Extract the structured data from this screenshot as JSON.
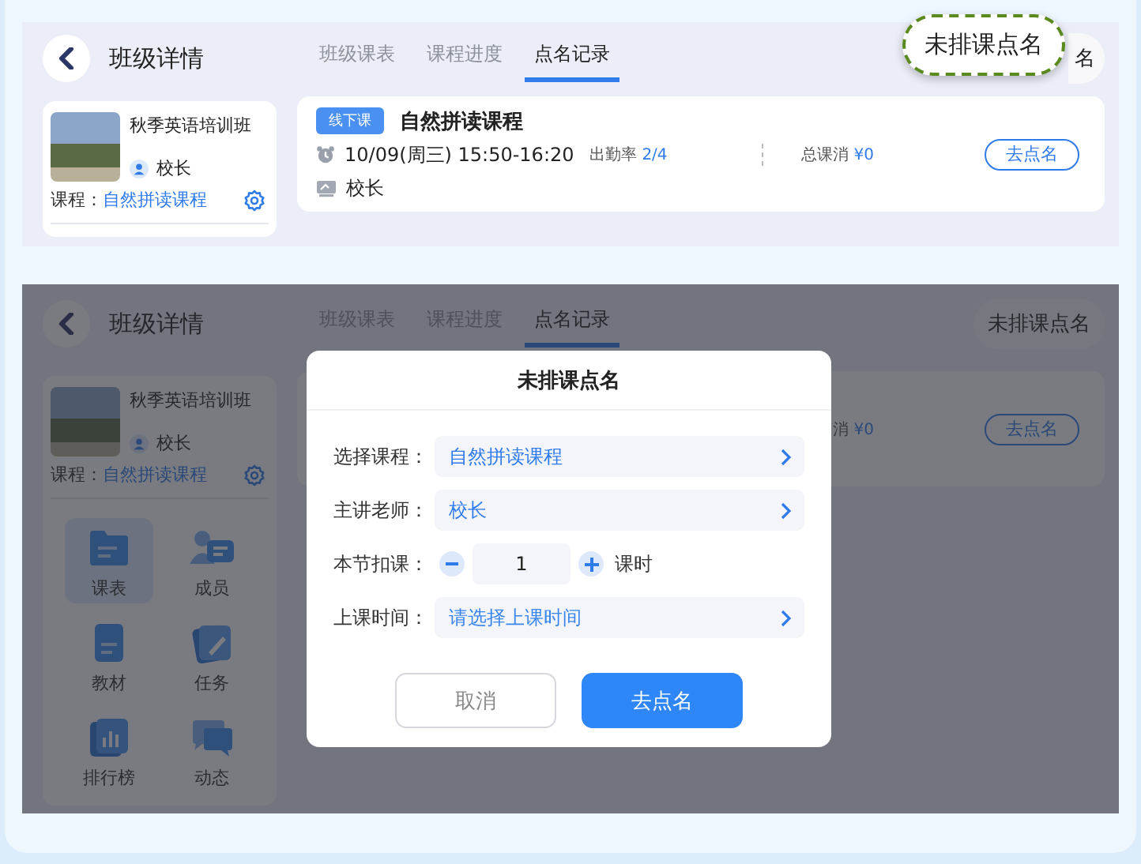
{
  "panels": [
    {
      "dimmed": false,
      "title": "班级详情",
      "tabs": [
        {
          "label": "班级课表",
          "selected": false
        },
        {
          "label": "课程进度",
          "selected": false
        },
        {
          "label": "点名记录",
          "selected": true
        }
      ],
      "action_button": {
        "label": "名"
      },
      "callout": {
        "label": "未排课点名"
      },
      "class_card": {
        "name": "秋季英语培训班",
        "teacher": "校长",
        "course_label": "课程：",
        "course": "自然拼读课程"
      },
      "record": {
        "tag": "线下课",
        "title": "自然拼读课程",
        "time": "10/09(周三) 15:50-16:20",
        "attendance_label": "出勤率",
        "attendance_value": "2/4",
        "consumption_label": "总课消",
        "consumption_value": "¥0",
        "teacher": "校长",
        "button": "去点名"
      }
    },
    {
      "dimmed": true,
      "title": "班级详情",
      "tabs": [
        {
          "label": "班级课表",
          "selected": false
        },
        {
          "label": "课程进度",
          "selected": false
        },
        {
          "label": "点名记录",
          "selected": true
        }
      ],
      "action_button": {
        "label": "未排课点名"
      },
      "class_card": {
        "name": "秋季英语培训班",
        "teacher": "校长",
        "course_label": "课程：",
        "course": "自然拼读课程",
        "nav_items": [
          {
            "label": "课表",
            "selected": true
          },
          {
            "label": "成员",
            "selected": false
          },
          {
            "label": "教材",
            "selected": false
          },
          {
            "label": "任务",
            "selected": false
          },
          {
            "label": "排行榜",
            "selected": false
          },
          {
            "label": "动态",
            "selected": false
          }
        ]
      },
      "record": {
        "consumption_label": "消",
        "consumption_value": "¥0",
        "button": "去点名"
      },
      "modal": {
        "title": "未排课点名",
        "rows": [
          {
            "kind": "select",
            "label": "选择课程：",
            "value": "自然拼读课程"
          },
          {
            "kind": "select",
            "label": "主讲老师：",
            "value": "校长"
          },
          {
            "kind": "stepper",
            "label": "本节扣课：",
            "value": "1",
            "unit": "课时"
          },
          {
            "kind": "select",
            "label": "上课时间：",
            "placeholder": "请选择上课时间"
          }
        ],
        "cancel": "取消",
        "confirm": "去点名"
      }
    }
  ]
}
